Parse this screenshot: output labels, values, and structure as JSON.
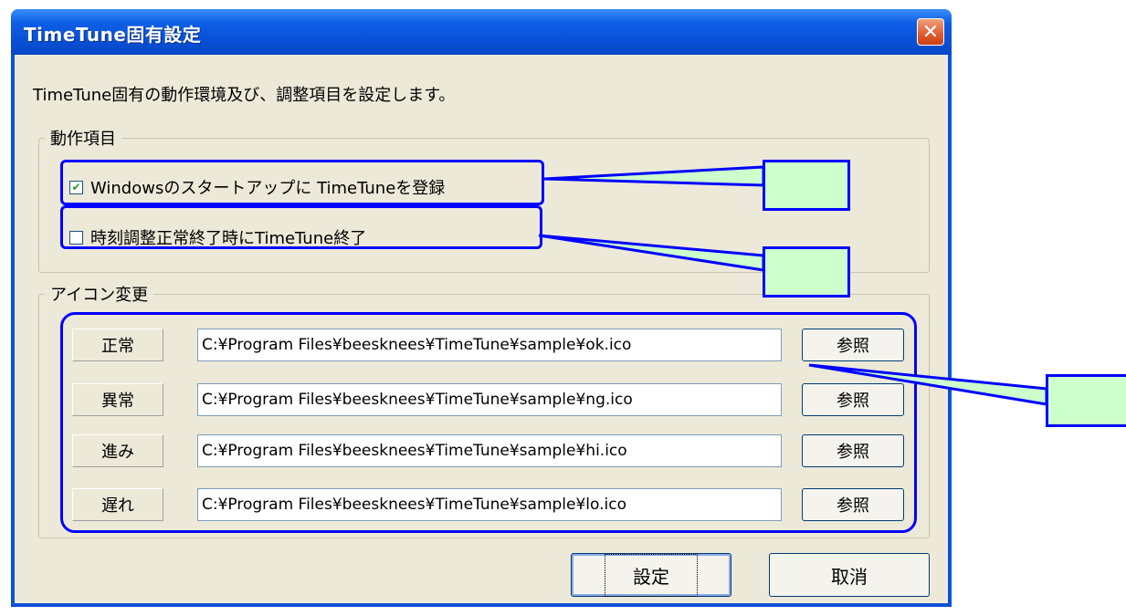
{
  "window": {
    "title": "TimeTune固有設定",
    "close_glyph": "✕"
  },
  "description": "TimeTune固有の動作環境及び、調整項目を設定します。",
  "groups": {
    "operation": {
      "label": "動作項目",
      "options": [
        {
          "label": "Windowsのスタートアップに TimeTuneを登録",
          "checked": true
        },
        {
          "label": "時刻調整正常終了時にTimeTune終了",
          "checked": false
        }
      ]
    },
    "icons": {
      "label": "アイコン変更",
      "rows": [
        {
          "label": "正常",
          "path": "C:¥Program Files¥beesknees¥TimeTune¥sample¥ok.ico",
          "browse": "参照"
        },
        {
          "label": "異常",
          "path": "C:¥Program Files¥beesknees¥TimeTune¥sample¥ng.ico",
          "browse": "参照"
        },
        {
          "label": "進み",
          "path": "C:¥Program Files¥beesknees¥TimeTune¥sample¥hi.ico",
          "browse": "参照"
        },
        {
          "label": "遅れ",
          "path": "C:¥Program Files¥beesknees¥TimeTune¥sample¥lo.ico",
          "browse": "参照"
        }
      ]
    }
  },
  "buttons": {
    "ok": "設定",
    "cancel": "取消"
  },
  "colors": {
    "title_bar": "#0a53d8",
    "dialog_bg": "#ece9d8",
    "highlight": "#0000ff",
    "callout_fill": "#ccffcc"
  }
}
